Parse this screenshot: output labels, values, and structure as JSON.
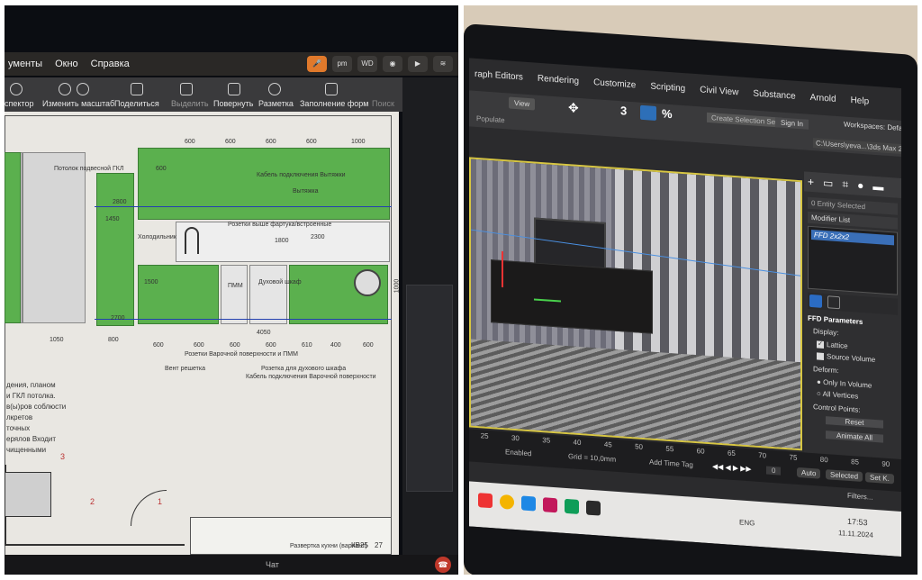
{
  "left": {
    "menubar": {
      "items": [
        "ументы",
        "Окно",
        "Справка"
      ],
      "status_icons": [
        "mic-icon",
        "pm",
        "WD",
        "camera-icon",
        "play-icon",
        "wifi-icon"
      ]
    },
    "toolbar": {
      "buttons": [
        {
          "label": "спектор",
          "icon": "info-icon"
        },
        {
          "label": "Изменить масштаб",
          "icon": "zoom-icon"
        },
        {
          "label": "Поделиться",
          "icon": "share-icon"
        },
        {
          "label": "Выделить",
          "icon": "pen-icon"
        },
        {
          "label": "Повернуть",
          "icon": "rotate-icon"
        },
        {
          "label": "Разметка",
          "icon": "markup-icon"
        },
        {
          "label": "Заполнение форм",
          "icon": "form-icon"
        },
        {
          "label": "Поиск",
          "icon": "search-icon"
        }
      ]
    },
    "drawing": {
      "top_dims": [
        "600",
        "600",
        "600",
        "600",
        "1000"
      ],
      "dims": [
        "600",
        "2800",
        "1450",
        "2300",
        "1800",
        "1500",
        "2700",
        "1000",
        "1050",
        "800",
        "600",
        "600",
        "600",
        "600",
        "610",
        "400",
        "600",
        "4050"
      ],
      "labels": {
        "ceiling": "Потолок подвесной ГКЛ",
        "cable": "Кабель подключения Вытяжки",
        "hood": "Вытяжка",
        "socket": "Розетки выше фартука/встроенные",
        "fridge": "Холодильник",
        "pmm": "ПММ",
        "oven": "Духовой шкаф",
        "sockets_bottom": "Розетки Варочной поверхности и ПММ",
        "valve": "Вент решетка",
        "socket_oven": "Розетка для духового шкафа",
        "cable_bottom": "Кабель подключения Варочной поверхности"
      },
      "notes": [
        "дения, планом",
        "и ГКЛ потолка.",
        "в(ы)ров соблюсти",
        "лкретов",
        "точных",
        "ерялов Входит",
        "чищенными"
      ],
      "markers": [
        "3",
        "2",
        "1"
      ],
      "sheet_title": "Развертка кухни (вариант)",
      "sheet_code": "КВ25",
      "sheet_num": "27"
    },
    "dock": {
      "chat_label": "Чат"
    }
  },
  "right": {
    "menu": [
      "raph Editors",
      "Rendering",
      "Customize",
      "Scripting",
      "Civil View",
      "Substance",
      "Arnold",
      "Help"
    ],
    "toolbar": {
      "populate": "Populate",
      "view_dropdown": "View",
      "snap_label": "3",
      "angle_label": "%",
      "create_selection": "Create Selection Set",
      "sign_in": "Sign In",
      "workspaces": "Workspaces: Default",
      "path": "C:\\Users\\yeva...\\3ds Max 202"
    },
    "command_panel": {
      "entity": "0 Entity Selected",
      "modifier_list": "Modifier List",
      "stack_item": "FFD 2x2x2",
      "section_title": "FFD Parameters",
      "display_label": "Display:",
      "lattice_label": "Lattice",
      "lattice_checked": true,
      "source_volume_label": "Source Volume",
      "source_volume_checked": false,
      "deform_label": "Deform:",
      "only_in_volume": "Only In Volume",
      "all_vertices": "All Vertices",
      "control_points_label": "Control Points:",
      "reset_btn": "Reset",
      "animate_all_btn": "Animate All"
    },
    "timeline": {
      "ticks": [
        "25",
        "30",
        "35",
        "40",
        "45",
        "50",
        "55",
        "60",
        "65",
        "70",
        "75",
        "80",
        "85",
        "90"
      ],
      "enabled_label": "Enabled",
      "grid_label": "Grid = 10,0mm",
      "add_time_tag": "Add Time Tag",
      "auto_label": "Auto",
      "selected_label": "Selected",
      "set_k": "Set K.",
      "filters": "Filters...",
      "frame_value": "0"
    },
    "taskbar": {
      "lang": "ENG",
      "time": "17:53",
      "date": "11.11.2024"
    }
  }
}
